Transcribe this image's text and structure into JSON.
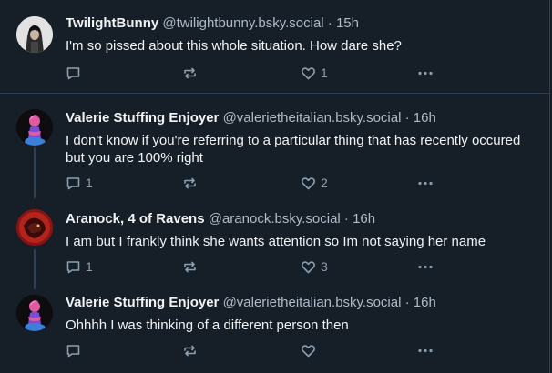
{
  "posts": [
    {
      "name": "TwilightBunny",
      "handle": "@twilightbunny.bsky.social",
      "sep": "·",
      "time": "15h",
      "text": "I'm so pissed about this whole situation. How dare she?",
      "replies": "",
      "likes": "1"
    },
    {
      "name": "Valerie Stuffing Enjoyer",
      "handle": "@valerietheitalian.bsky.social",
      "sep": "·",
      "time": "16h",
      "text": "I don't know if you're referring to a particular thing that has recently occured but you are 100% right",
      "replies": "1",
      "likes": "2"
    },
    {
      "name": "Aranock, 4 of Ravens",
      "handle": "@aranock.bsky.social",
      "sep": "·",
      "time": "16h",
      "text": "I am but I frankly think she wants attention so Im not saying her name",
      "replies": "1",
      "likes": "3"
    },
    {
      "name": "Valerie Stuffing Enjoyer",
      "handle": "@valerietheitalian.bsky.social",
      "sep": "·",
      "time": "16h",
      "text": "Ohhhh I was thinking of a different person then",
      "replies": "",
      "likes": ""
    }
  ],
  "icons": {
    "reply": "reply-icon",
    "repost": "repost-icon",
    "like": "heart-icon",
    "more": "more-icon"
  },
  "colors": {
    "background": "#161e27",
    "divider": "#2e4052",
    "text": "#f1f3f5",
    "muted": "#aebbc9",
    "icon": "#8c9fb1"
  }
}
